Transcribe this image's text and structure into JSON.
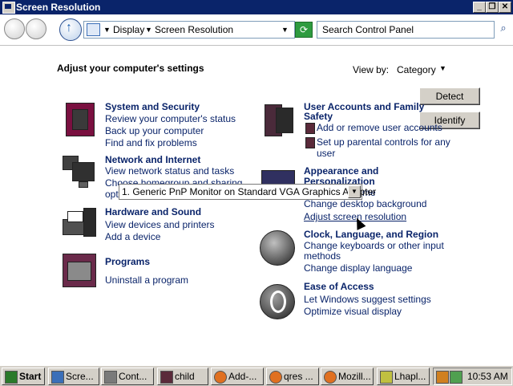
{
  "window": {
    "title": "Screen Resolution",
    "controls": [
      "minimize-icon",
      "restore-icon",
      "close-icon"
    ]
  },
  "nav": {
    "breadcrumb": [
      "Display",
      "Screen Resolution"
    ],
    "search_placeholder": "Search Control Panel"
  },
  "main": {
    "heading": "Adjust your computer's settings",
    "view_by_label": "View by:",
    "view_by_value": "Category"
  },
  "categories": [
    {
      "title": "System and Security",
      "links": [
        "Review your computer's status",
        "Back up your computer",
        "Find and fix problems"
      ]
    },
    {
      "title": "Network and Internet",
      "links": [
        "View network status and tasks",
        "Choose homegroup and sharing",
        "opt"
      ]
    },
    {
      "title": "Hardware and Sound",
      "links": [
        "View devices and printers",
        "Add a device"
      ]
    },
    {
      "title": "Programs",
      "links": [
        "Uninstall a program"
      ]
    },
    {
      "title_line1": "User Accounts and Family",
      "title_line2": "Safety",
      "links": [
        "Add or remove user accounts",
        "Set up parental controls for any",
        "user"
      ]
    },
    {
      "title_line1": "Appearance and",
      "title_line2": "Personalization",
      "links": [
        "me",
        "Change desktop background",
        "Adjust screen resolution"
      ]
    },
    {
      "title": "Clock, Language, and Region",
      "links": [
        "Change keyboards or other input",
        "methods",
        "Change display language"
      ]
    },
    {
      "title": "Ease of Access",
      "links": [
        "Let Windows suggest settings",
        "Optimize visual display"
      ]
    }
  ],
  "dialog": {
    "detect_label": "Detect",
    "identify_label": "Identify",
    "display_select": "1. Generic PnP Monitor on Standard VGA Graphics Adapter"
  },
  "taskbar": {
    "start_label": "Start",
    "items": [
      "Scre...",
      "Cont...",
      "child",
      "Add-...",
      "qres ...",
      "Mozill...",
      "Lhapl..."
    ],
    "clock": "10:53 AM"
  },
  "colors": {
    "titlebar": "#0a246a",
    "link": "#0a246a",
    "chrome": "#d4d0c8"
  }
}
